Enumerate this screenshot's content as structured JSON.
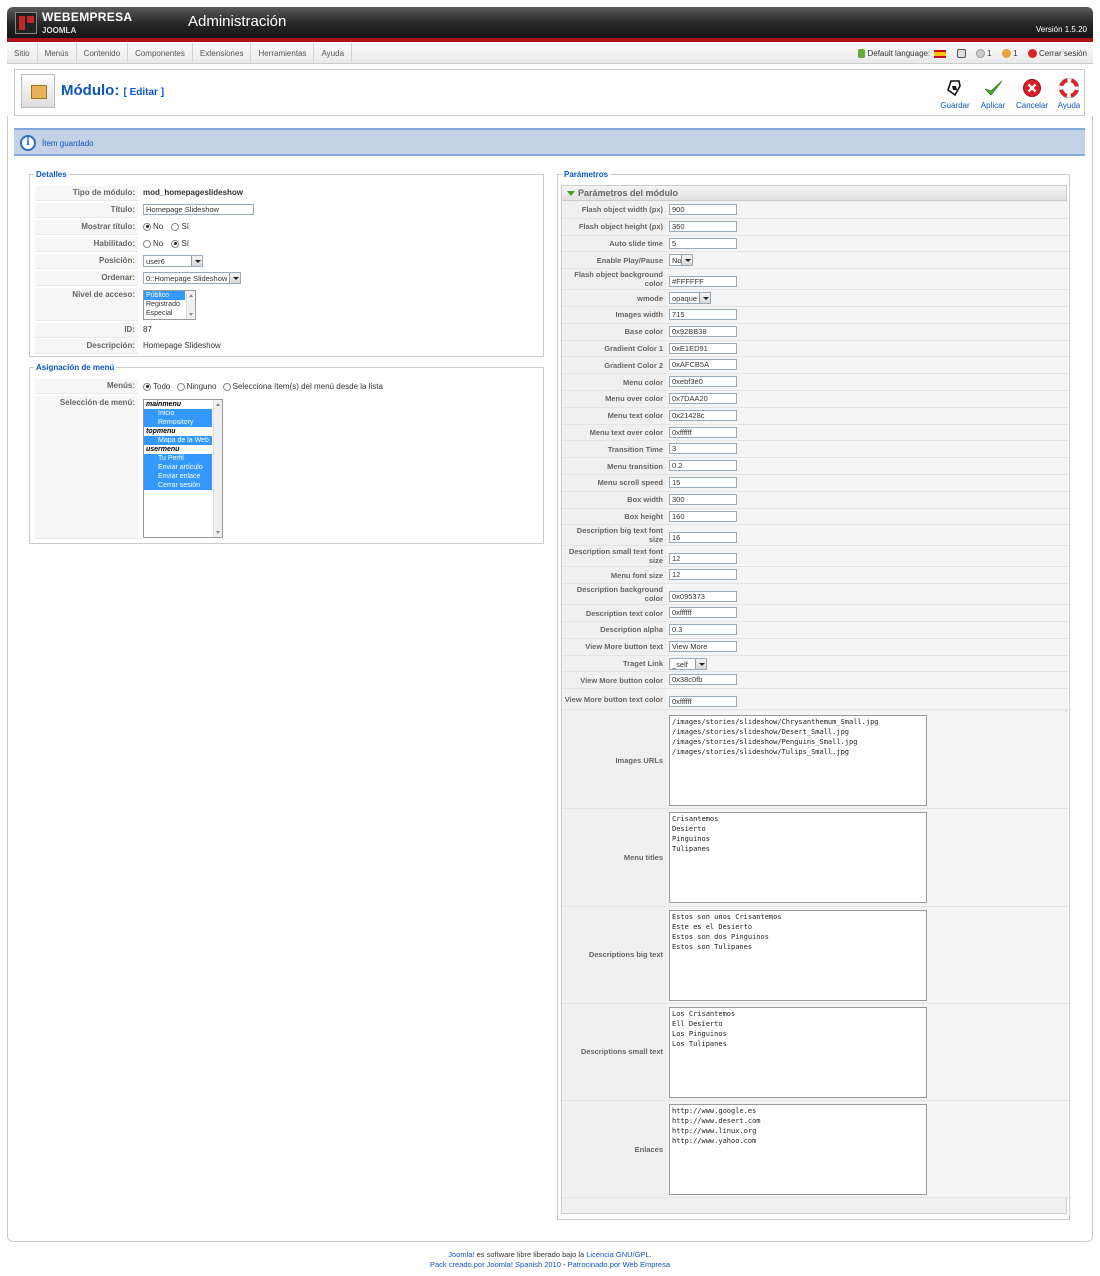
{
  "header": {
    "brand": "WEBEMPRESA",
    "brand_sub": "JOOMLA",
    "title": "Administración",
    "version": "Versión 1.5.20"
  },
  "menu": [
    "Sitio",
    "Menús",
    "Contenido",
    "Componentes",
    "Extensiones",
    "Herramientas",
    "Ayuda"
  ],
  "status": {
    "default_language": "Default language:",
    "messages": "1",
    "users": "1",
    "logout": "Cerrar sesión"
  },
  "toolbar": {
    "title": "Módulo:",
    "subtitle": "[ Editar ]",
    "save": "Guardar",
    "apply": "Aplicar",
    "cancel": "Cancelar",
    "help": "Ayuda"
  },
  "message": "Ítem guardado",
  "details": {
    "legend": "Detalles",
    "type_label": "Tipo de módulo:",
    "type_value": "mod_homepageslideshow",
    "title_label": "Título:",
    "title_value": "Homepage Slideshow",
    "show_title_label": "Mostrar título:",
    "no": "No",
    "yes": "Sí",
    "enabled_label": "Habilitado:",
    "position_label": "Posición:",
    "position_value": "user6",
    "order_label": "Ordenar:",
    "order_value": "0::Homepage Slideshow",
    "access_label": "Nivel de acceso:",
    "access_options": [
      "Público",
      "Registrado",
      "Especial"
    ],
    "id_label": "ID:",
    "id_value": "87",
    "desc_label": "Descripción:",
    "desc_value": "Homepage Slideshow"
  },
  "menu_assign": {
    "legend": "Asignación de menú",
    "menus_label": "Menús:",
    "all": "Todo",
    "none": "Ninguno",
    "select": "Selecciona ítem(s) del menú desde la lista",
    "selection_label": "Selección de menú:",
    "groups": [
      {
        "name": "mainmenu",
        "items": [
          "Inicio",
          "Remository"
        ]
      },
      {
        "name": "topmenu",
        "items": [
          "Mapa de la Web"
        ]
      },
      {
        "name": "usermenu",
        "items": [
          "Tu Perfil",
          "Enviar artículo",
          "Enviar enlace",
          "Cerrar sesión"
        ]
      }
    ]
  },
  "params": {
    "legend": "Parámetros",
    "section": "Parámetros del módulo",
    "rows": [
      {
        "label": "Flash object width (px)",
        "value": "900"
      },
      {
        "label": "Flash object height (px)",
        "value": "360"
      },
      {
        "label": "Auto slide time",
        "value": "5"
      },
      {
        "label": "Enable Play/Pause",
        "value": "No"
      },
      {
        "label": "Flash object background color",
        "value": "#FFFFFF"
      },
      {
        "label": "wmode",
        "value": "opaque"
      },
      {
        "label": "Images width",
        "value": "715"
      },
      {
        "label": "Base color",
        "value": "0x92BB38"
      },
      {
        "label": "Gradient Color 1",
        "value": "0xE1ED91"
      },
      {
        "label": "Gradient Color 2",
        "value": "0xAFCB5A"
      },
      {
        "label": "Menu color",
        "value": "0xebf3e0"
      },
      {
        "label": "Menu over color",
        "value": "0x7DAA20"
      },
      {
        "label": "Menu text color",
        "value": "0x21428c"
      },
      {
        "label": "Menu text over color",
        "value": "0xffffff"
      },
      {
        "label": "Transition Time",
        "value": "3"
      },
      {
        "label": "Menu transition",
        "value": "0.2"
      },
      {
        "label": "Menu scroll speed",
        "value": "15"
      },
      {
        "label": "Box width",
        "value": "300"
      },
      {
        "label": "Box height",
        "value": "160"
      },
      {
        "label": "Description big text font size",
        "value": "16"
      },
      {
        "label": "Description small text font size",
        "value": "12"
      },
      {
        "label": "Menu font size",
        "value": "12"
      },
      {
        "label": "Description background color",
        "value": "0x095373"
      },
      {
        "label": "Description text color",
        "value": "0xffffff"
      },
      {
        "label": "Description alpha",
        "value": "0.3"
      },
      {
        "label": "View More button text",
        "value": "View More"
      },
      {
        "label": "Traget Link",
        "value": "_self"
      },
      {
        "label": "View More button color",
        "value": "0x38c0fb"
      },
      {
        "label": "View More button text color",
        "value": "0xffffff"
      }
    ],
    "images_urls_label": "Images URLs",
    "images_urls": "/images/stories/slideshow/Chrysanthemum_Small.jpg\n/images/stories/slideshow/Desert_Small.jpg\n/images/stories/slideshow/Penguins_Small.jpg\n/images/stories/slideshow/Tulips_Small.jpg",
    "menu_titles_label": "Menu titles",
    "menu_titles": "Crisantemos\nDesierto\nPinguinos\nTulipanes",
    "desc_big_label": "Descriptions big text",
    "desc_big": "Estos son unos Crisantemos\nEste es el Desierto\nEstos son dos Pinguinos\nEstos son Tulipanes",
    "desc_small_label": "Descriptions small text",
    "desc_small": "Los Crisantemos\nEll Desierto\nLos Pinguinos\nLos Tulipanes",
    "links_label": "Enlaces",
    "links": "http://www.google.es\nhttp://www.desert.com\nhttp://www.linux.org\nhttp://www.yahoo.com"
  },
  "footer": {
    "joomla": "Joomla!",
    "line1_mid": " es software libre liberado bajo la ",
    "license": "Licencia GNU/GPL",
    "line1_end": ".",
    "pack": "Pack creado por Joomla! Spanish 2010",
    "sep": " - ",
    "sponsor": "Patrocinado por Web Empresa"
  },
  "colors": {
    "accent": "#0b55c4",
    "header_red": "#a8141a",
    "message_bg": "#c3d2e5",
    "selected": "#3399ff"
  }
}
